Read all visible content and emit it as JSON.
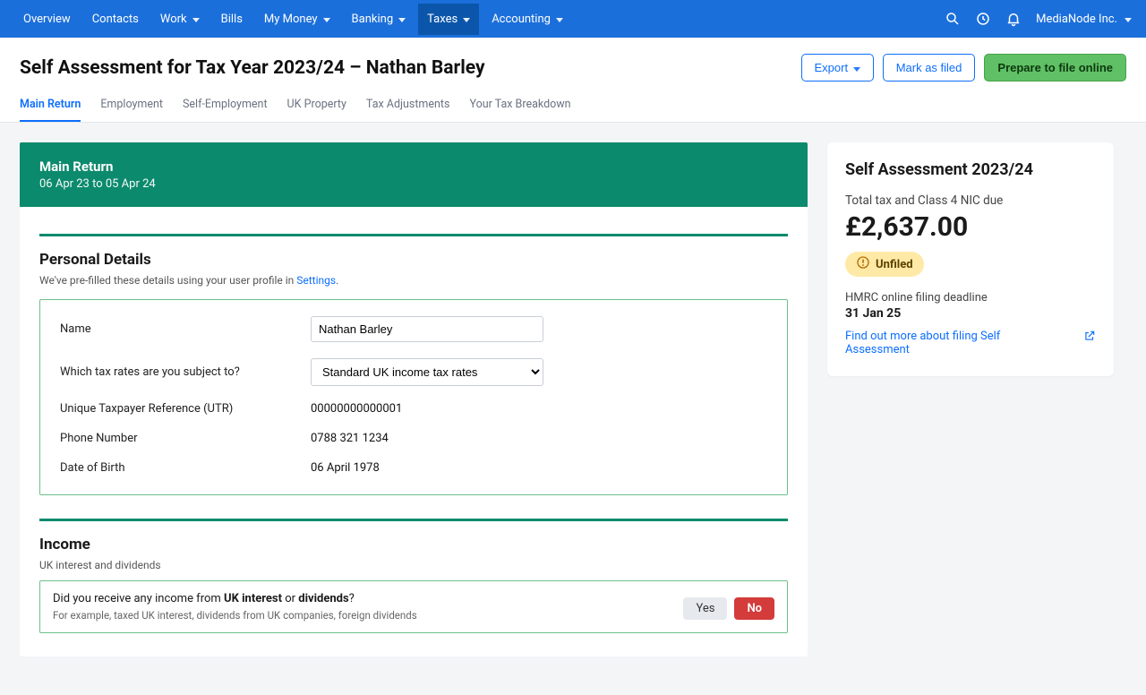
{
  "nav": {
    "items": [
      {
        "label": "Overview",
        "dropdown": false,
        "active": false
      },
      {
        "label": "Contacts",
        "dropdown": false,
        "active": false
      },
      {
        "label": "Work",
        "dropdown": true,
        "active": false
      },
      {
        "label": "Bills",
        "dropdown": false,
        "active": false
      },
      {
        "label": "My Money",
        "dropdown": true,
        "active": false
      },
      {
        "label": "Banking",
        "dropdown": true,
        "active": false
      },
      {
        "label": "Taxes",
        "dropdown": true,
        "active": true
      },
      {
        "label": "Accounting",
        "dropdown": true,
        "active": false
      }
    ],
    "company": "MediaNode Inc."
  },
  "header": {
    "title": "Self Assessment for Tax Year 2023/24 – Nathan Barley",
    "export": "Export",
    "mark_as_filed": "Mark as filed",
    "prepare": "Prepare to file online"
  },
  "tabs": [
    {
      "label": "Main Return",
      "active": true
    },
    {
      "label": "Employment",
      "active": false
    },
    {
      "label": "Self-Employment",
      "active": false
    },
    {
      "label": "UK Property",
      "active": false
    },
    {
      "label": "Tax Adjustments",
      "active": false
    },
    {
      "label": "Your Tax Breakdown",
      "active": false
    }
  ],
  "banner": {
    "title": "Main Return",
    "period": "06 Apr 23 to 05 Apr 24"
  },
  "personal": {
    "heading": "Personal Details",
    "pretext": "We've pre-filled these details using your user profile in ",
    "settings_link": "Settings",
    "fields": {
      "name_label": "Name",
      "name_value": "Nathan Barley",
      "rates_label": "Which tax rates are you subject to?",
      "rates_value": "Standard UK income tax rates",
      "utr_label": "Unique Taxpayer Reference (UTR)",
      "utr_value": "00000000000001",
      "phone_label": "Phone Number",
      "phone_value": "0788 321 1234",
      "dob_label": "Date of Birth",
      "dob_value": "06 April 1978"
    }
  },
  "income": {
    "heading": "Income",
    "sub": "UK interest and dividends",
    "question_prefix": "Did you receive any income from ",
    "bold1": "UK interest",
    "mid": " or ",
    "bold2": "dividends",
    "question_suffix": "?",
    "hint": "For example, taxed UK interest, dividends from UK companies, foreign dividends",
    "yes": "Yes",
    "no": "No"
  },
  "sidebar": {
    "title": "Self Assessment 2023/24",
    "due_label": "Total tax and Class 4 NIC due",
    "amount": "£2,637.00",
    "status": "Unfiled",
    "deadline_label": "HMRC online filing deadline",
    "deadline_date": "31 Jan 25",
    "learn_more": "Find out more about filing Self Assessment"
  }
}
